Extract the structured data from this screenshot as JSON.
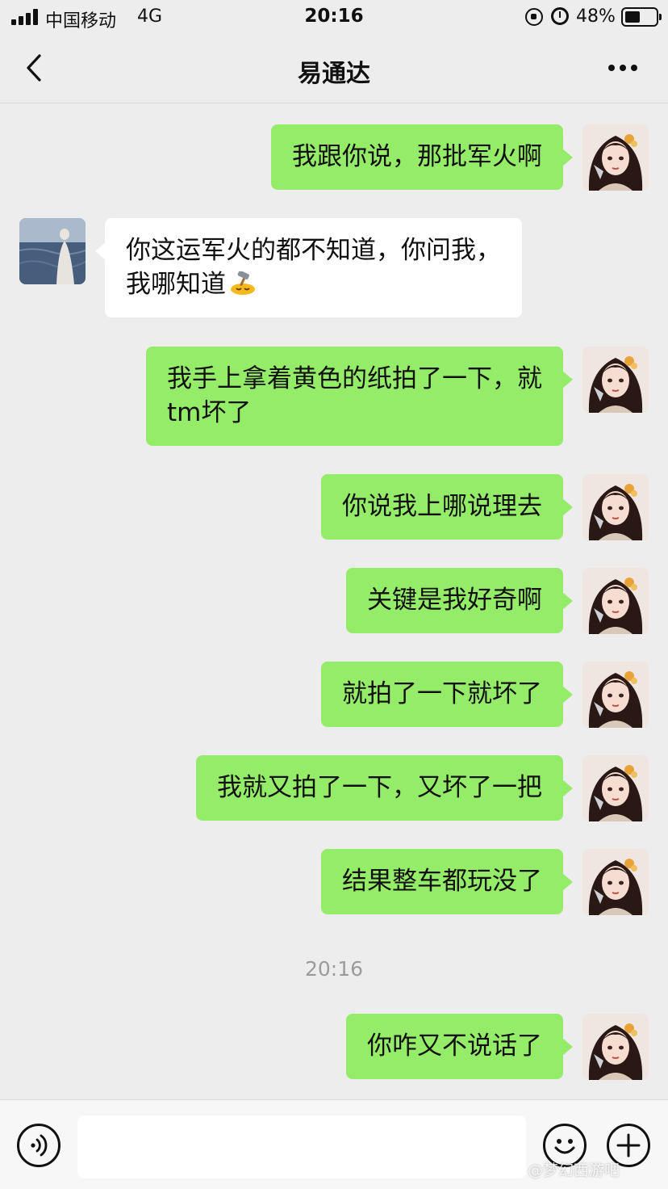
{
  "status_bar": {
    "carrier": "中国移动",
    "network": "4G",
    "time": "20:16",
    "battery_percent_label": "48%",
    "battery_level": 0.48,
    "icons": [
      "signal-icon",
      "rotation-lock-icon",
      "alarm-icon",
      "battery-icon"
    ]
  },
  "header": {
    "title": "易通达",
    "back_icon": "chevron-left-icon",
    "more_icon": "more-dots-icon"
  },
  "messages": [
    {
      "side": "right",
      "text": "我跟你说，那批军火啊"
    },
    {
      "side": "left",
      "text": "你这运军火的都不知道，你问我，\n我哪知道",
      "emoji": "hammer-face-emoji"
    },
    {
      "side": "right",
      "text": "我手上拿着黄色的纸拍了一下，就\ntm坏了"
    },
    {
      "side": "right",
      "text": "你说我上哪说理去"
    },
    {
      "side": "right",
      "text": "关键是我好奇啊"
    },
    {
      "side": "right",
      "text": "就拍了一下就坏了"
    },
    {
      "side": "right",
      "text": "我就又拍了一下，又坏了一把"
    },
    {
      "side": "right",
      "text": "结果整车都玩没了"
    },
    {
      "side": "right",
      "text": "你咋又不说话了"
    }
  ],
  "time_divider": "20:16",
  "input_bar": {
    "placeholder": "",
    "voice_icon": "voice-icon",
    "emoji_icon": "emoji-icon",
    "plus_icon": "plus-icon"
  },
  "watermark": "@梦幻西游吧",
  "colors": {
    "background": "#ededed",
    "sent_bubble": "#95ec69",
    "received_bubble": "#ffffff",
    "input_bar": "#f7f7f7"
  }
}
